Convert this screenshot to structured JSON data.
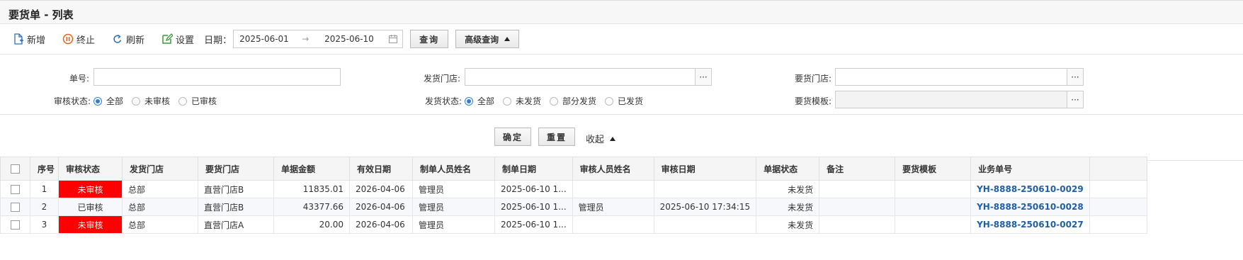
{
  "page": {
    "title": "要货单 - 列表"
  },
  "toolbar": {
    "add": "新增",
    "stop": "终止",
    "refresh": "刷新",
    "settings": "设置",
    "date_label": "日期：",
    "date_from": "2025-06-01",
    "date_sep": "→",
    "date_to": "2025-06-10",
    "query": "查询",
    "advanced": "高级查询"
  },
  "filters": {
    "order_no_label": "单号:",
    "ship_store_label": "发货门店:",
    "req_store_label": "要货门店:",
    "audit_label": "审核状态:",
    "audit_options": [
      "全部",
      "未审核",
      "已审核"
    ],
    "ship_label": "发货状态:",
    "ship_options": [
      "全部",
      "未发货",
      "部分发货",
      "已发货"
    ],
    "template_label": "要货模板:",
    "dots": "···",
    "confirm": "确定",
    "reset": "重置",
    "collapse": "收起"
  },
  "table": {
    "columns": [
      "",
      "序号",
      "审核状态",
      "发货门店",
      "要货门店",
      "单据金额",
      "有效日期",
      "制单人员姓名",
      "制单日期",
      "审核人员姓名",
      "审核日期",
      "单据状态",
      "备注",
      "要货模板",
      "业务单号"
    ],
    "rows": [
      {
        "seq": "1",
        "audit": "未审核",
        "ship_store": "总部",
        "req_store": "直营门店B",
        "amount": "11835.01",
        "valid": "2026-04-06",
        "maker": "管理员",
        "make_date": "2025-06-10 1...",
        "auditor": "",
        "audit_date": "",
        "status": "未发货",
        "remark": "",
        "template": "",
        "biz_no": "YH-8888-250610-0029"
      },
      {
        "seq": "2",
        "audit": "已审核",
        "ship_store": "总部",
        "req_store": "直营门店B",
        "amount": "43377.66",
        "valid": "2026-04-06",
        "maker": "管理员",
        "make_date": "2025-06-10 1...",
        "auditor": "管理员",
        "audit_date": "2025-06-10 17:34:15",
        "status": "未发货",
        "remark": "",
        "template": "",
        "biz_no": "YH-8888-250610-0028"
      },
      {
        "seq": "3",
        "audit": "未审核",
        "ship_store": "总部",
        "req_store": "直营门店A",
        "amount": "20.00",
        "valid": "2026-04-06",
        "maker": "管理员",
        "make_date": "2025-06-10 1...",
        "auditor": "",
        "audit_date": "",
        "status": "未发货",
        "remark": "",
        "template": "",
        "biz_no": "YH-8888-250610-0027"
      }
    ]
  },
  "colors": {
    "unaudited_bg": "#ff0000",
    "link": "#1f5fa8",
    "radio_on": "#2f7fd0"
  }
}
